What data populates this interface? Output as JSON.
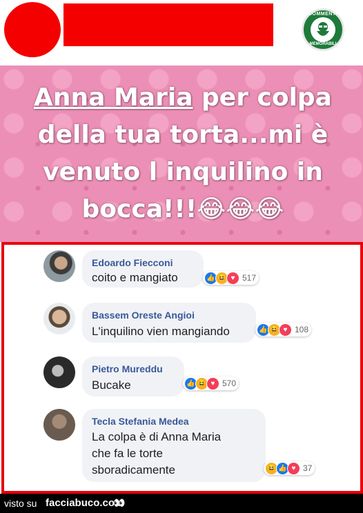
{
  "post": {
    "badge_top": "COMMENTI",
    "badge_bottom": "MEMORABILI",
    "meme_text_line1_a": "Anna Maria",
    "meme_text_line1_b": " per colpa",
    "meme_text_line2": "della tua torta...mi è",
    "meme_text_line3": "venuto l inquilino in",
    "meme_text_line4": "bocca!!!😂😂😂"
  },
  "comments": [
    {
      "name": "Edoardo Fiecconi",
      "text": [
        "coito e mangiato"
      ],
      "reactions": [
        "like",
        "haha",
        "love"
      ],
      "count": "517"
    },
    {
      "name": "Bassem Oreste Angioi",
      "text": [
        "L'inquilino vien mangiando"
      ],
      "reactions": [
        "like",
        "haha",
        "love"
      ],
      "count": "108"
    },
    {
      "name": "Pietro Mureddu",
      "text": [
        "Bucake"
      ],
      "reactions": [
        "like",
        "haha",
        "love"
      ],
      "count": "570"
    },
    {
      "name": "Tecla Stefania Medea",
      "text": [
        "La colpa è di Anna Maria",
        "che fa le torte",
        "sboradicamente"
      ],
      "reactions": [
        "haha",
        "like",
        "love"
      ],
      "count": "37"
    }
  ],
  "footer": {
    "prefix": "visto su",
    "site": "facciabuco.com",
    "eyes": "👀"
  },
  "colors": {
    "redaction": "#f40000",
    "frame": "#e8000b",
    "meme_bg": "#ec8fb6",
    "name_link": "#385898",
    "like": "#1877f2",
    "haha": "#f7b125",
    "love": "#f33e58"
  }
}
